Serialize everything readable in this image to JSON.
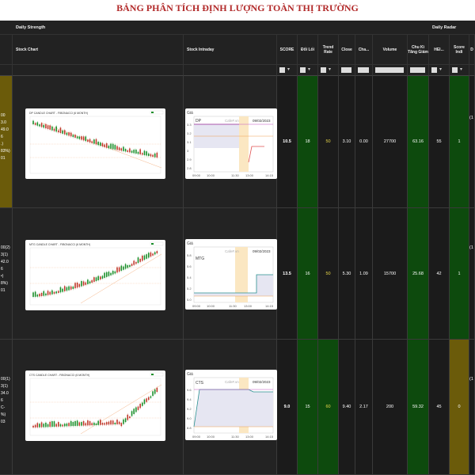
{
  "page_title": "BẢNG PHÂN TÍCH ĐỊNH LƯỢNG TOÀN THỊ TRƯỜNG",
  "header_groups": {
    "daily_strength": "Daily Strength",
    "daily_radar": "Daily Radar"
  },
  "columns": {
    "stock_chart": "Stock Chart",
    "stock_intraday": "Stock Intraday",
    "score": "SCORE",
    "doi_loi": "Đổi Lối",
    "trend_rate": "Trend Rate",
    "close": "Close",
    "change": "Cha...",
    "volume": "Volume",
    "chu_ki": "Chu Kì Tăng Giảm",
    "hei": "HEI...",
    "score_indi": "Score Indi",
    "d": "D"
  },
  "colors": {
    "green": "#0d4a0d",
    "olive": "#6b5b0a",
    "yellow_value": "#e8d64a"
  },
  "rows": [
    {
      "left_info": [
        "00",
        "3.0",
        "49.0",
        "6",
        ".)",
        "83%)",
        "01"
      ],
      "chart_title": "DP CANDLE CHART - FIBONACCI (6 MONTH)",
      "intraday": {
        "ylabel": "Giá",
        "symbol": "DP",
        "watermark": "CafeF.vn",
        "date": "09/02/2023",
        "yticks": [
          "3.3",
          "3.2",
          "3.1",
          "3",
          "2.9",
          "2.8"
        ],
        "xticks": [
          "09:00",
          "10:00",
          "11:30",
          "13:00",
          "14:15"
        ]
      },
      "score": "10.5",
      "doi_loi": "18",
      "trend_rate": "50",
      "close": "3.10",
      "change": "0.00",
      "volume": "27700",
      "chu_ki": "63.16",
      "hei": "55",
      "score_indi": "1",
      "right": "(1"
    },
    {
      "left_info": [
        "00(2)",
        "3(1)",
        "42.0",
        "6",
        "•)",
        "8%)",
        "01"
      ],
      "chart_title": "MTG CANDLE CHART - FIBONACCI (6 MONTH)",
      "intraday": {
        "ylabel": "Giá",
        "symbol": "MTG",
        "watermark": "CafeF.vn",
        "date": "09/02/2023",
        "yticks": [
          "5.8",
          "5.6",
          "5.4",
          "5.2",
          "5.0"
        ],
        "xticks": [
          "09:00",
          "10:00",
          "11:30",
          "13:00",
          "14:15"
        ]
      },
      "score": "13.5",
      "doi_loi": "16",
      "trend_rate": "50",
      "close": "5.30",
      "change": "1.09",
      "volume": "15700",
      "chu_ki": "25.68",
      "hei": "42",
      "score_indi": "1",
      "right": "(1"
    },
    {
      "left_info": [
        "00(1)",
        "3(1)",
        "34.0",
        "6",
        "C-",
        "%)",
        "03"
      ],
      "chart_title": "CTS CANDLE CHART - FIBONACCI (6 MONTH)",
      "intraday": {
        "ylabel": "Giá",
        "symbol": "CTS",
        "watermark": "CafeF.vn",
        "date": "09/02/2023",
        "yticks": [
          "9.6",
          "9.4",
          "9.2",
          "9.0",
          "8.8"
        ],
        "xticks": [
          "09:00",
          "10:00",
          "11:30",
          "13:00",
          "14:15"
        ]
      },
      "score": "9.0",
      "doi_loi": "15",
      "trend_rate": "60",
      "close": "9.40",
      "change": "2.17",
      "volume": "200",
      "chu_ki": "59.32",
      "hei": "45",
      "score_indi": "0",
      "right": "(1"
    }
  ]
}
